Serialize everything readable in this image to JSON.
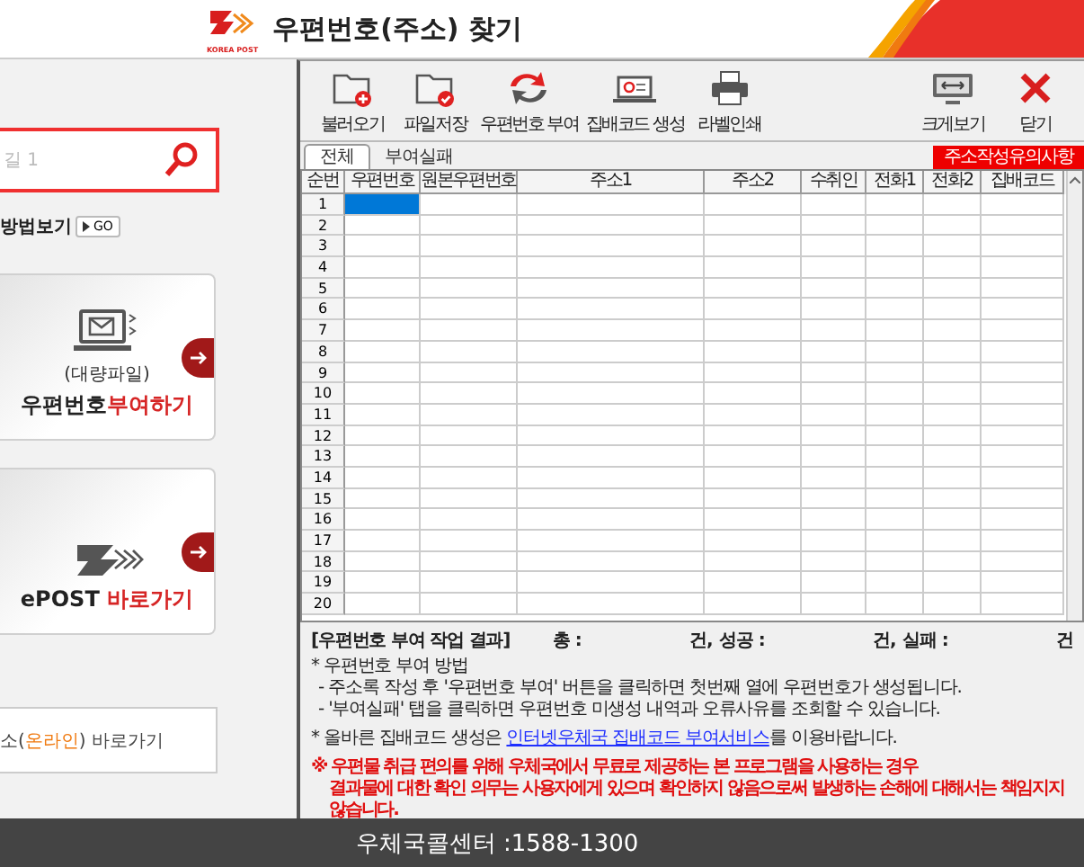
{
  "header": {
    "title": "우편번호(주소) 찾기",
    "logo_text": "KOREA POST"
  },
  "left_panel": {
    "search": {
      "placeholder": "길 1"
    },
    "guide": {
      "label": "방법보기",
      "button": "GO"
    },
    "cards": [
      {
        "kind": "bulk",
        "sub": "(대량파일)",
        "title": "우편번호",
        "title_accent": "부여하기"
      },
      {
        "kind": "epost",
        "title": "ePOST ",
        "title_accent": "바로가기"
      }
    ],
    "link": {
      "prefix": "소(",
      "accent": "온라인",
      "suffix": ") 바로가기"
    }
  },
  "toolbar": [
    {
      "kind": "open",
      "label": "불러오기"
    },
    {
      "kind": "save",
      "label": "파일저장"
    },
    {
      "kind": "assign",
      "label": "우편번호 부여"
    },
    {
      "kind": "code",
      "label": "집배코드 생성"
    },
    {
      "kind": "print",
      "label": "라벨인쇄"
    },
    {
      "kind": "zoom",
      "label": "크게보기"
    },
    {
      "kind": "close",
      "label": "닫기"
    }
  ],
  "tabs": [
    {
      "label": "전체",
      "selected": true
    },
    {
      "label": "부여실패",
      "selected": false
    }
  ],
  "notice_button": "주소작성유의사항",
  "grid": {
    "columns": [
      "순번",
      "우편번호",
      "원본우편번호",
      "주소1",
      "주소2",
      "수취인",
      "전화1",
      "전화2",
      "집배코드"
    ],
    "rows": [
      {
        "num": "1",
        "selected": true
      },
      {
        "num": "2",
        "selected": false
      },
      {
        "num": "3",
        "selected": false
      },
      {
        "num": "4",
        "selected": false
      },
      {
        "num": "5",
        "selected": false
      },
      {
        "num": "6",
        "selected": false
      },
      {
        "num": "7",
        "selected": false
      },
      {
        "num": "8",
        "selected": false
      },
      {
        "num": "9",
        "selected": false
      },
      {
        "num": "10",
        "selected": false
      },
      {
        "num": "11",
        "selected": false
      },
      {
        "num": "12",
        "selected": false
      },
      {
        "num": "13",
        "selected": false
      },
      {
        "num": "14",
        "selected": false
      },
      {
        "num": "15",
        "selected": false
      },
      {
        "num": "16",
        "selected": false
      },
      {
        "num": "17",
        "selected": false
      },
      {
        "num": "18",
        "selected": false
      },
      {
        "num": "19",
        "selected": false
      },
      {
        "num": "20",
        "selected": false
      }
    ]
  },
  "results": {
    "title": "[우편번호 부여 작업 결과]",
    "items": [
      {
        "label": "총 :",
        "unit": "건,"
      },
      {
        "label": "성공 :",
        "unit": "건,"
      },
      {
        "label": "실패 :",
        "unit": "건"
      }
    ]
  },
  "info": {
    "heading": "* 우편번호 부여 방법",
    "lines": [
      "- 주소록 작성 후 '우편번호 부여' 버튼을 클릭하면 첫번째 열에 우편번호가 생성됩니다.",
      "- '부여실패' 탭을 클릭하면 우편번호 미생성 내역과 오류사유를 조회할 수 있습니다."
    ],
    "link_sentence": {
      "before": "* 올바른 집배코드 생성은 ",
      "link": "인터넷우체국 집배코드 부여서비스",
      "after": "를 이용바랍니다."
    },
    "warning": [
      "※ 우편물 취급 편의를 위해 우체국에서 무료로 제공하는 본 프로그램을 사용하는 경우",
      "결과물에 대한 확인 의무는 사용자에게 있으며 확인하지 않음으로써 발생하는 손해에 대해서는 책임지지 않습니다."
    ]
  },
  "footer": "우체국콜센터 :1588-1300"
}
